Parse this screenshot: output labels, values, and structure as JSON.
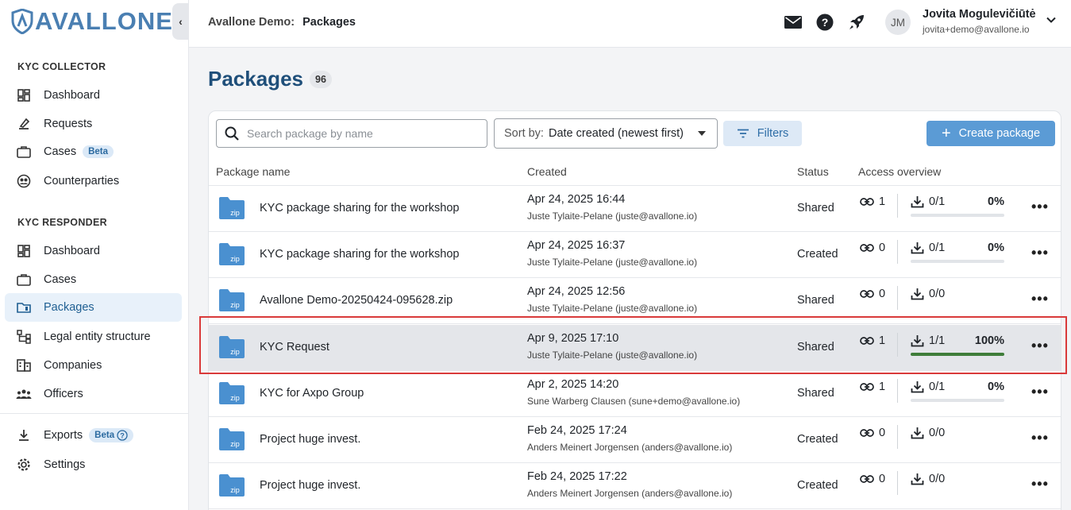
{
  "brand": {
    "name": "AVALLONE"
  },
  "sidebar": {
    "collector_title": "KYC COLLECTOR",
    "collector_items": [
      {
        "label": "Dashboard",
        "icon": "dashboard-icon"
      },
      {
        "label": "Requests",
        "icon": "requests-icon"
      },
      {
        "label": "Cases",
        "icon": "briefcase-icon",
        "badge": "Beta"
      },
      {
        "label": "Counterparties",
        "icon": "counterparties-icon"
      }
    ],
    "responder_title": "KYC RESPONDER",
    "responder_items": [
      {
        "label": "Dashboard",
        "icon": "dashboard-icon"
      },
      {
        "label": "Cases",
        "icon": "briefcase-icon"
      },
      {
        "label": "Packages",
        "icon": "package-folder-icon",
        "active": true
      },
      {
        "label": "Legal entity structure",
        "icon": "hierarchy-icon"
      },
      {
        "label": "Companies",
        "icon": "building-icon"
      },
      {
        "label": "Officers",
        "icon": "people-icon"
      }
    ],
    "bottom_items": [
      {
        "label": "Exports",
        "icon": "download-icon",
        "badge": "Beta"
      },
      {
        "label": "Settings",
        "icon": "gear-icon"
      }
    ]
  },
  "header": {
    "org": "Avallone Demo:",
    "page": "Packages",
    "user": {
      "initials": "JM",
      "name": "Jovita Mogulevičiūtė",
      "email": "jovita+demo@avallone.io"
    }
  },
  "main": {
    "title": "Packages",
    "count": "96",
    "search_placeholder": "Search package by name",
    "sort_label": "Sort by:",
    "sort_value": "Date created (newest first)",
    "filters_label": "Filters",
    "create_label": "Create package",
    "columns": [
      "Package name",
      "Created",
      "Status",
      "Access overview"
    ],
    "rows": [
      {
        "name": "KYC package sharing for the workshop",
        "date": "Apr 24, 2025 16:44",
        "by": "Juste Tylaite-Pelane (juste@avallone.io)",
        "status": "Shared",
        "links": "1",
        "downloads": "0/1",
        "percent": "0%",
        "progress": 0
      },
      {
        "name": "KYC package sharing for the workshop",
        "date": "Apr 24, 2025 16:37",
        "by": "Juste Tylaite-Pelane (juste@avallone.io)",
        "status": "Created",
        "links": "0",
        "downloads": "0/1",
        "percent": "0%",
        "progress": 0
      },
      {
        "name": "Avallone Demo-20250424-095628.zip",
        "date": "Apr 24, 2025 12:56",
        "by": "Juste Tylaite-Pelane (juste@avallone.io)",
        "status": "Shared",
        "links": "0",
        "downloads": "0/0",
        "percent": "",
        "progress": null
      },
      {
        "name": "KYC Request",
        "date": "Apr 9, 2025 17:10",
        "by": "Juste Tylaite-Pelane (juste@avallone.io)",
        "status": "Shared",
        "links": "1",
        "downloads": "1/1",
        "percent": "100%",
        "progress": 1.0,
        "highlighted": true
      },
      {
        "name": "KYC for Axpo Group",
        "date": "Apr 2, 2025 14:20",
        "by": "Sune Warberg Clausen (sune+demo@avallone.io)",
        "status": "Shared",
        "links": "1",
        "downloads": "0/1",
        "percent": "0%",
        "progress": 0
      },
      {
        "name": "Project huge invest.",
        "date": "Feb 24, 2025 17:24",
        "by": "Anders Meinert Jorgensen (anders@avallone.io)",
        "status": "Created",
        "links": "0",
        "downloads": "0/0",
        "percent": "",
        "progress": null
      },
      {
        "name": "Project huge invest.",
        "date": "Feb 24, 2025 17:22",
        "by": "Anders Meinert Jorgensen (anders@avallone.io)",
        "status": "Created",
        "links": "0",
        "downloads": "0/0",
        "percent": "",
        "progress": null
      }
    ]
  },
  "colors": {
    "brand": "#4a7fb2",
    "primary": "#5b9bd5",
    "title": "#1f4f7a",
    "progress": "#3f7d3a",
    "highlight": "#d93a3a",
    "folder": "#4a90d0"
  }
}
